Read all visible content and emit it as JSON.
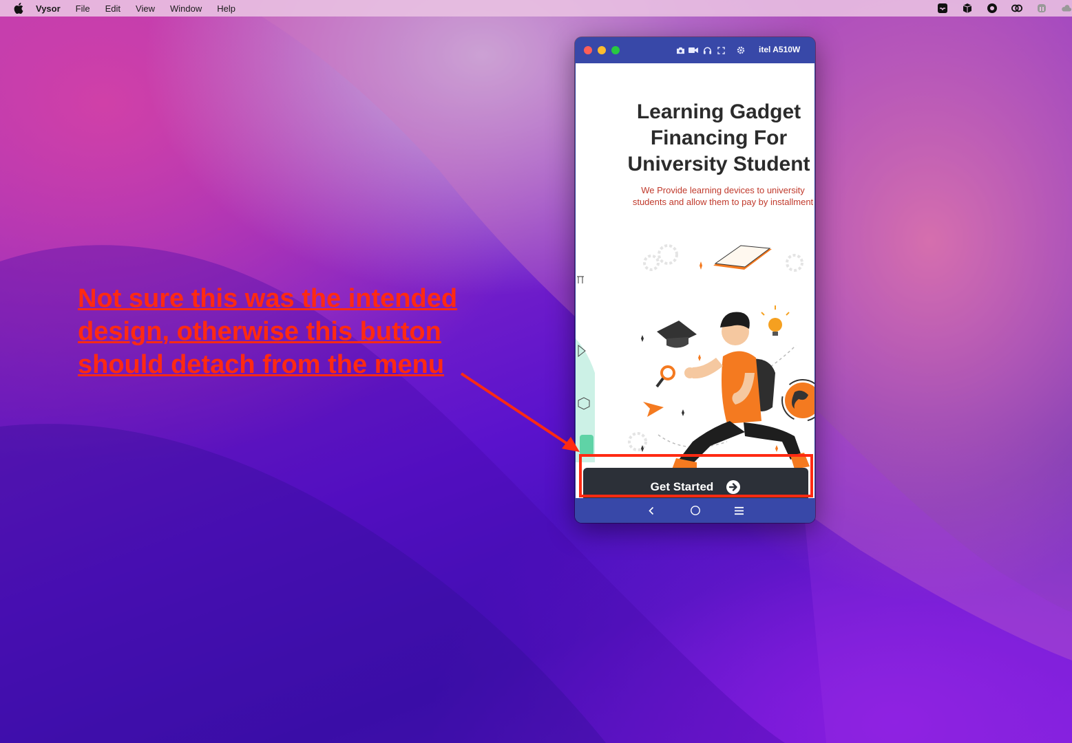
{
  "menubar": {
    "app_name": "Vysor",
    "items": [
      "File",
      "Edit",
      "View",
      "Window",
      "Help"
    ],
    "tray_icons": [
      "inbox-icon",
      "cube-icon",
      "bug-icon",
      "creative-cloud-icon",
      "airpods-icon",
      "cloud-icon"
    ]
  },
  "window": {
    "device_name": "itel A510W",
    "toolbar_icons": [
      "camera-icon",
      "video-icon",
      "headphones-icon",
      "fullscreen-icon",
      "gear-icon"
    ]
  },
  "screen": {
    "headline_lines": [
      "Learning Gadget",
      "Financing For",
      "University Student"
    ],
    "subtitle_lines": [
      "We Provide learning devices to university",
      "students and allow them to pay by installment"
    ],
    "cta_label": "Get Started",
    "cta_icon": "arrow-right-circle-icon"
  },
  "navbar": {
    "icons": [
      "back-icon",
      "home-icon",
      "menu-icon"
    ]
  },
  "annotation": {
    "lines": [
      "Not sure this was the intended",
      "design, otherwise this button",
      "should detach from the menu"
    ],
    "color": "#ff2a12"
  },
  "colors": {
    "window_blue": "#3848a8",
    "cta_dark": "#2c3038",
    "accent_orange": "#f47a20",
    "subtitle_red": "#c0392b"
  }
}
